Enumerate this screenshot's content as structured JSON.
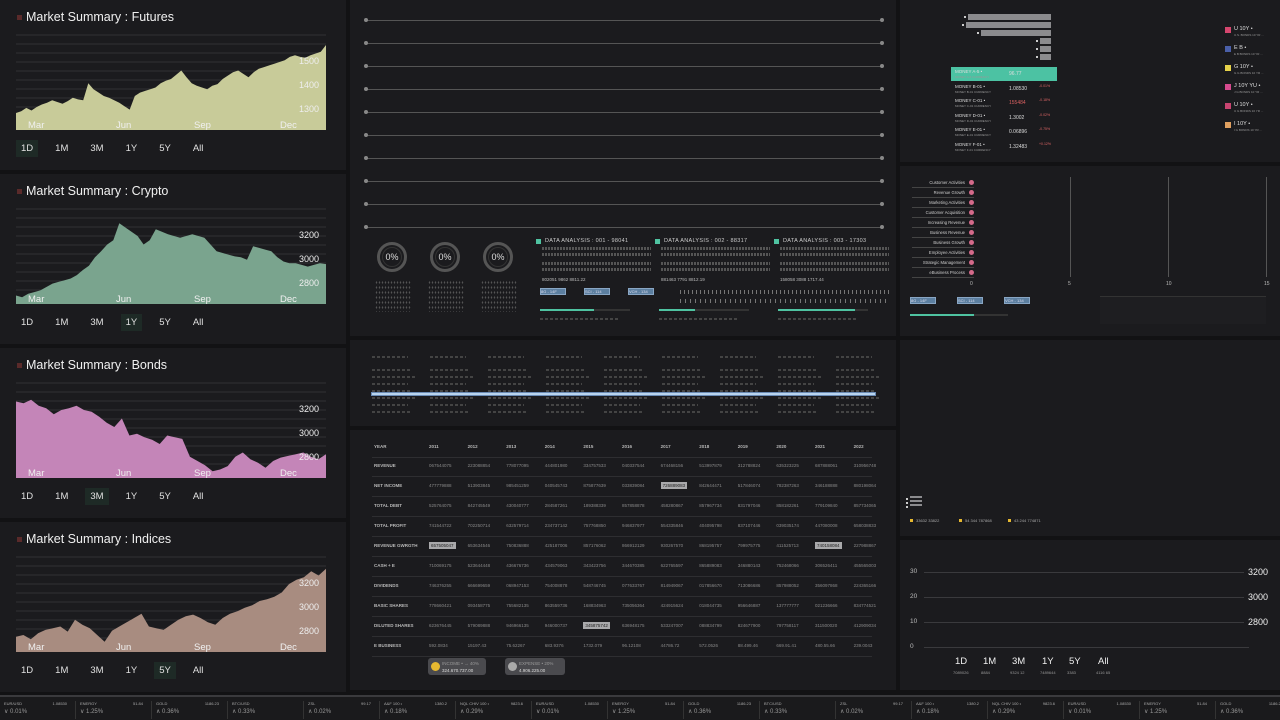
{
  "market_summaries": [
    {
      "title": "Market Summary : Futures",
      "color": "#c8cb99",
      "y_ticks": [
        "1500",
        "1400",
        "1300"
      ],
      "months": [
        "Mar",
        "Jun",
        "Sep",
        "Dec"
      ],
      "active_tab": "1D",
      "series": [
        20,
        22,
        26,
        23,
        27,
        30,
        32,
        35,
        33,
        31,
        34,
        38,
        36,
        35,
        55,
        48,
        44,
        40,
        38,
        35,
        32,
        28,
        24,
        40,
        44,
        46,
        48,
        50,
        55,
        58,
        60,
        65,
        70,
        62,
        55,
        52,
        50,
        48,
        52,
        54,
        60,
        64,
        68,
        70,
        66,
        62,
        68,
        72,
        74,
        76,
        78,
        80,
        82,
        86,
        88,
        86,
        85,
        88,
        90,
        92,
        100
      ]
    },
    {
      "title": "Market Summary : Crypto",
      "color": "#7aa48e",
      "y_ticks": [
        "3200",
        "3000",
        "2800"
      ],
      "months": [
        "Mar",
        "Jun",
        "Sep",
        "Dec"
      ],
      "active_tab": "1Y",
      "series": [
        10,
        8,
        12,
        14,
        16,
        20,
        24,
        26,
        28,
        30,
        34,
        40,
        45,
        55,
        62,
        70,
        75,
        95,
        90,
        85,
        80,
        70,
        75,
        88,
        85,
        82,
        80,
        78,
        80,
        82,
        80,
        78,
        70,
        62,
        60,
        58,
        56,
        55,
        52,
        68,
        66,
        64,
        62,
        55,
        50,
        48,
        48,
        46,
        44,
        46,
        48,
        47
      ]
    },
    {
      "title": "Market Summary : Bonds",
      "color": "#c485b8",
      "y_ticks": [
        "3200",
        "3000",
        "2800"
      ],
      "months": [
        "Mar",
        "Jun",
        "Sep",
        "Dec"
      ],
      "active_tab": "3M",
      "series": [
        90,
        88,
        92,
        85,
        82,
        75,
        80,
        82,
        85,
        80,
        78,
        72,
        65,
        60,
        70,
        50,
        52,
        48,
        45,
        40,
        50,
        48,
        46,
        25,
        20,
        15,
        8,
        10,
        14,
        25,
        30,
        22,
        18,
        12,
        20,
        24,
        26,
        28,
        30,
        25,
        22,
        28
      ]
    },
    {
      "title": "Market Summary : Indices",
      "color": "#a88c80",
      "y_ticks": [
        "3200",
        "3000",
        "2800"
      ],
      "months": [
        "Mar",
        "Jun",
        "Sep",
        "Dec"
      ],
      "active_tab": "5Y",
      "series": [
        18,
        20,
        15,
        22,
        26,
        28,
        30,
        24,
        38,
        32,
        28,
        20,
        12,
        25,
        30,
        35,
        40,
        45,
        30,
        28,
        26,
        32,
        38,
        42,
        44,
        40,
        35,
        32,
        40,
        45,
        48,
        52,
        55,
        60,
        62,
        65,
        70,
        80,
        85,
        88,
        95,
        90,
        98
      ]
    }
  ],
  "range_tabs": [
    "1D",
    "1M",
    "3M",
    "1Y",
    "5Y",
    "All"
  ],
  "gauges": [
    {
      "value": "0%"
    },
    {
      "value": "0%"
    },
    {
      "value": "0%"
    }
  ],
  "data_analysis": [
    {
      "title": "DATA ANALYSIS : 001 - 98041",
      "footer": "802051   9862   8811.22",
      "tag": "8G - 14F"
    },
    {
      "title": "DATA ANALYSIS : 002 - 88317",
      "footer": "881463   7791   8812.19",
      "tag": "SCI - 114"
    },
    {
      "title": "DATA ANALYSIS : 003 - 17303",
      "footer": "158058   3088   1717.44",
      "tag": "VCH - 134"
    }
  ],
  "money_rows": [
    {
      "name": "MONEY A-5 •",
      "sub": "MONEY A-5 CURRENCY",
      "value": "96.77",
      "change": "",
      "selected": true
    },
    {
      "name": "MONEY B-01 •",
      "sub": "MONEY B-01 CURRENCY",
      "value": "1.08530",
      "change": "-0.01%"
    },
    {
      "name": "MONEY C-01 •",
      "sub": "MONEY C-01 CURRENCY",
      "value": "155484",
      "change": "-0.18%",
      "value_color": "#d86060"
    },
    {
      "name": "MONEY D-01 •",
      "sub": "MONEY D-01 CURRENCY",
      "value": "1.3002",
      "change": "-0.02%"
    },
    {
      "name": "MONEY E-01 •",
      "sub": "MONEY E-01 CURRENCY",
      "value": "0.06896",
      "change": "-0.75%"
    },
    {
      "name": "MONEY F-01 •",
      "sub": "MONEY F-01 CURRENCY",
      "value": "1.32483",
      "change": "+0.12%"
    }
  ],
  "bond_legend": [
    {
      "label": "U 10Y •",
      "sub": "U.S. BONDS 10 YR ...",
      "color": "#d6466e"
    },
    {
      "label": "E B •",
      "sub": "E B BONDS 10 YR ...",
      "color": "#4a5fa8"
    },
    {
      "label": "G 10Y •",
      "sub": "G G BONDS 10 YR ...",
      "color": "#e6d24a"
    },
    {
      "label": "J 10Y YU •",
      "sub": "J G BONDS 10 YR ...",
      "color": "#d64a8e"
    },
    {
      "label": "U 10Y •",
      "sub": "U G BONDS 10 YR ...",
      "color": "#c84470"
    },
    {
      "label": "I 10Y •",
      "sub": "I G BONDS 10 YR ...",
      "color": "#e0a060"
    }
  ],
  "activities": [
    "Customer Activities",
    "Revenue Growth",
    "Marketing Activities",
    "Customer Acquisition",
    "Increasing Revenue",
    "Business Revenue",
    "Business Growth",
    "Employee Activities",
    "Strategic Management",
    "eBusiness Process"
  ],
  "activity_axis": [
    "0",
    "5",
    "10",
    "15"
  ],
  "right_tags": [
    "8G - 14F",
    "SCI - 114",
    "VCH - 134"
  ],
  "fin_table": {
    "years": [
      "YEAR",
      "2011",
      "2012",
      "2013",
      "2014",
      "2015",
      "2016",
      "2017",
      "2018",
      "2019",
      "2020",
      "2021",
      "2022"
    ],
    "rows": [
      {
        "label": "REVENUE",
        "cells": [
          "067544075",
          "223088854",
          "778077095",
          "444801980",
          "334757533",
          "040337544",
          "674468156",
          "513997879",
          "312788824",
          "635323225",
          "687888061",
          "310956748"
        ]
      },
      {
        "label": "NET INCOME",
        "cells": [
          "477779888",
          "513903845",
          "985451259",
          "040545743",
          "875877639",
          "033839084",
          "726889083",
          "842644471",
          "517846074",
          "782387263",
          "346188888",
          "880198064"
        ],
        "hl": [
          6
        ]
      },
      {
        "label": "TOTAL DEBT",
        "cells": [
          "525764075",
          "842745549",
          "430040777",
          "284587261",
          "189388339",
          "857858878",
          "458280867",
          "857967734",
          "831797046",
          "858182261",
          "779109840",
          "857734065"
        ]
      },
      {
        "label": "TOTAL PROFIT",
        "cells": [
          "741544722",
          "702250714",
          "632579714",
          "234737142",
          "757768850",
          "946837977",
          "554335846",
          "404095798",
          "837107446",
          "039035174",
          "447080008",
          "658038833"
        ]
      },
      {
        "label": "REVENUE GWRGTH",
        "cells": [
          "657505047",
          "653634546",
          "750836888",
          "425187006",
          "857176062",
          "866912129",
          "930267570",
          "868195757",
          "799975775",
          "411525713",
          "740158084",
          "227988867"
        ],
        "hl": [
          0,
          10
        ]
      },
      {
        "label": "CASH + E",
        "cells": [
          "710069175",
          "523644448",
          "436676736",
          "434579063",
          "343423756",
          "344670385",
          "622765597",
          "865889083",
          "346880143",
          "752468066",
          "306526411",
          "455565003"
        ]
      },
      {
        "label": "DIVIDENDS",
        "cells": [
          "746376255",
          "666699659",
          "068947153",
          "754008878",
          "548746745",
          "077633767",
          "814949067",
          "017856670",
          "713086686",
          "857988052",
          "356097868",
          "224365166"
        ]
      },
      {
        "label": "BASIC SHARES",
        "cells": [
          "778660421",
          "093458775",
          "755682135",
          "863559736",
          "168834963",
          "735056364",
          "424915624",
          "018044735",
          "956646887",
          "137777777",
          "021236666",
          "834774521"
        ]
      },
      {
        "label": "DILUTED SHARES",
        "cells": [
          "623676445",
          "579089888",
          "946966135",
          "946000737",
          "345875742",
          "636948175",
          "533247007",
          "088834799",
          "824677900",
          "797758117",
          "311500020",
          "412909034"
        ],
        "hl": [
          4
        ]
      },
      {
        "label": "E BUSINESS",
        "cells": [
          "592.0834",
          "15197.43",
          "75.62267",
          "683.9376",
          "1732.079",
          "96.12108",
          "44786.72",
          "572.0526",
          "88.499.46",
          "669.91.41",
          "480.55.66",
          "239.0043"
        ]
      }
    ]
  },
  "badges": [
    {
      "label": "INCOME • → 40%",
      "value": "324.670.737.00",
      "icon_color": "#e6b830"
    },
    {
      "label": "EXPENSE • 20%",
      "value": "4.906.225.00",
      "icon_color": "#aaaaaa"
    }
  ],
  "mini_legend": [
    "33632  33822",
    "54  344  787868",
    "43  244  774871"
  ],
  "rb_chart": {
    "left_ticks": [
      "30",
      "20",
      "10",
      "0"
    ],
    "right_ticks": [
      "3200",
      "3000",
      "2800"
    ],
    "tabs": [
      {
        "label": "1D",
        "value": "7089026"
      },
      {
        "label": "1M",
        "value": "8884"
      },
      {
        "label": "3M",
        "value": "9324 12"
      },
      {
        "label": "1Y",
        "value": "7489644"
      },
      {
        "label": "5Y",
        "value": "3383"
      },
      {
        "label": "All",
        "value": "4116 65"
      }
    ]
  },
  "ticker": [
    {
      "name": "EUR/USD",
      "price": "1.08530",
      "change": "∨ 0.01%"
    },
    {
      "name": "ENERGY",
      "price": "51.84",
      "change": "∨ 1.25%"
    },
    {
      "name": "GOLD",
      "price": "1186.23",
      "change": "∧ 0.36%"
    },
    {
      "name": "BTC/USD",
      "price": "",
      "change": "∧ 0.33%"
    },
    {
      "name": "ZSL",
      "price": "99.17",
      "change": "∧ 0.02%"
    },
    {
      "name": "A&F 100 •",
      "price": "1380.2",
      "change": "∧ 0.18%"
    },
    {
      "name": "NQL CHIV 100 •",
      "price": "9823.6",
      "change": "∧ 0.29%"
    },
    {
      "name": "EUR/USD",
      "price": "1.08530",
      "change": "∨ 0.01%"
    },
    {
      "name": "ENERGY",
      "price": "51.84",
      "change": "∨ 1.25%"
    },
    {
      "name": "GOLD",
      "price": "1186.23",
      "change": "∧ 0.36%"
    },
    {
      "name": "BTC/USD",
      "price": "",
      "change": "∧ 0.33%"
    },
    {
      "name": "ZSL",
      "price": "99.17",
      "change": "∧ 0.02%"
    },
    {
      "name": "A&F 100 •",
      "price": "1380.2",
      "change": "∧ 0.18%"
    },
    {
      "name": "NQL CHIV 100 •",
      "price": "9823.6",
      "change": "∧ 0.29%"
    },
    {
      "name": "EUR/USD",
      "price": "1.08530",
      "change": "∨ 0.01%"
    },
    {
      "name": "ENERGY",
      "price": "51.84",
      "change": "∨ 1.25%"
    },
    {
      "name": "GOLD",
      "price": "1186.23",
      "change": "∧ 0.36%"
    }
  ],
  "chart_data": [
    {
      "type": "area",
      "title": "Market Summary : Futures",
      "x": [
        "Mar",
        "Jun",
        "Sep",
        "Dec"
      ],
      "ylim": [
        1250,
        1520
      ],
      "yticks": [
        1300,
        1400,
        1500
      ]
    },
    {
      "type": "area",
      "title": "Market Summary : Crypto",
      "x": [
        "Mar",
        "Jun",
        "Sep",
        "Dec"
      ],
      "ylim": [
        2750,
        3400
      ],
      "yticks": [
        2800,
        3000,
        3200
      ]
    },
    {
      "type": "area",
      "title": "Market Summary : Bonds",
      "x": [
        "Mar",
        "Jun",
        "Sep",
        "Dec"
      ],
      "ylim": [
        2750,
        3400
      ],
      "yticks": [
        2800,
        3000,
        3200
      ]
    },
    {
      "type": "area",
      "title": "Market Summary : Indices",
      "x": [
        "Mar",
        "Jun",
        "Sep",
        "Dec"
      ],
      "ylim": [
        2750,
        3300
      ],
      "yticks": [
        2800,
        3000,
        3200
      ]
    }
  ]
}
